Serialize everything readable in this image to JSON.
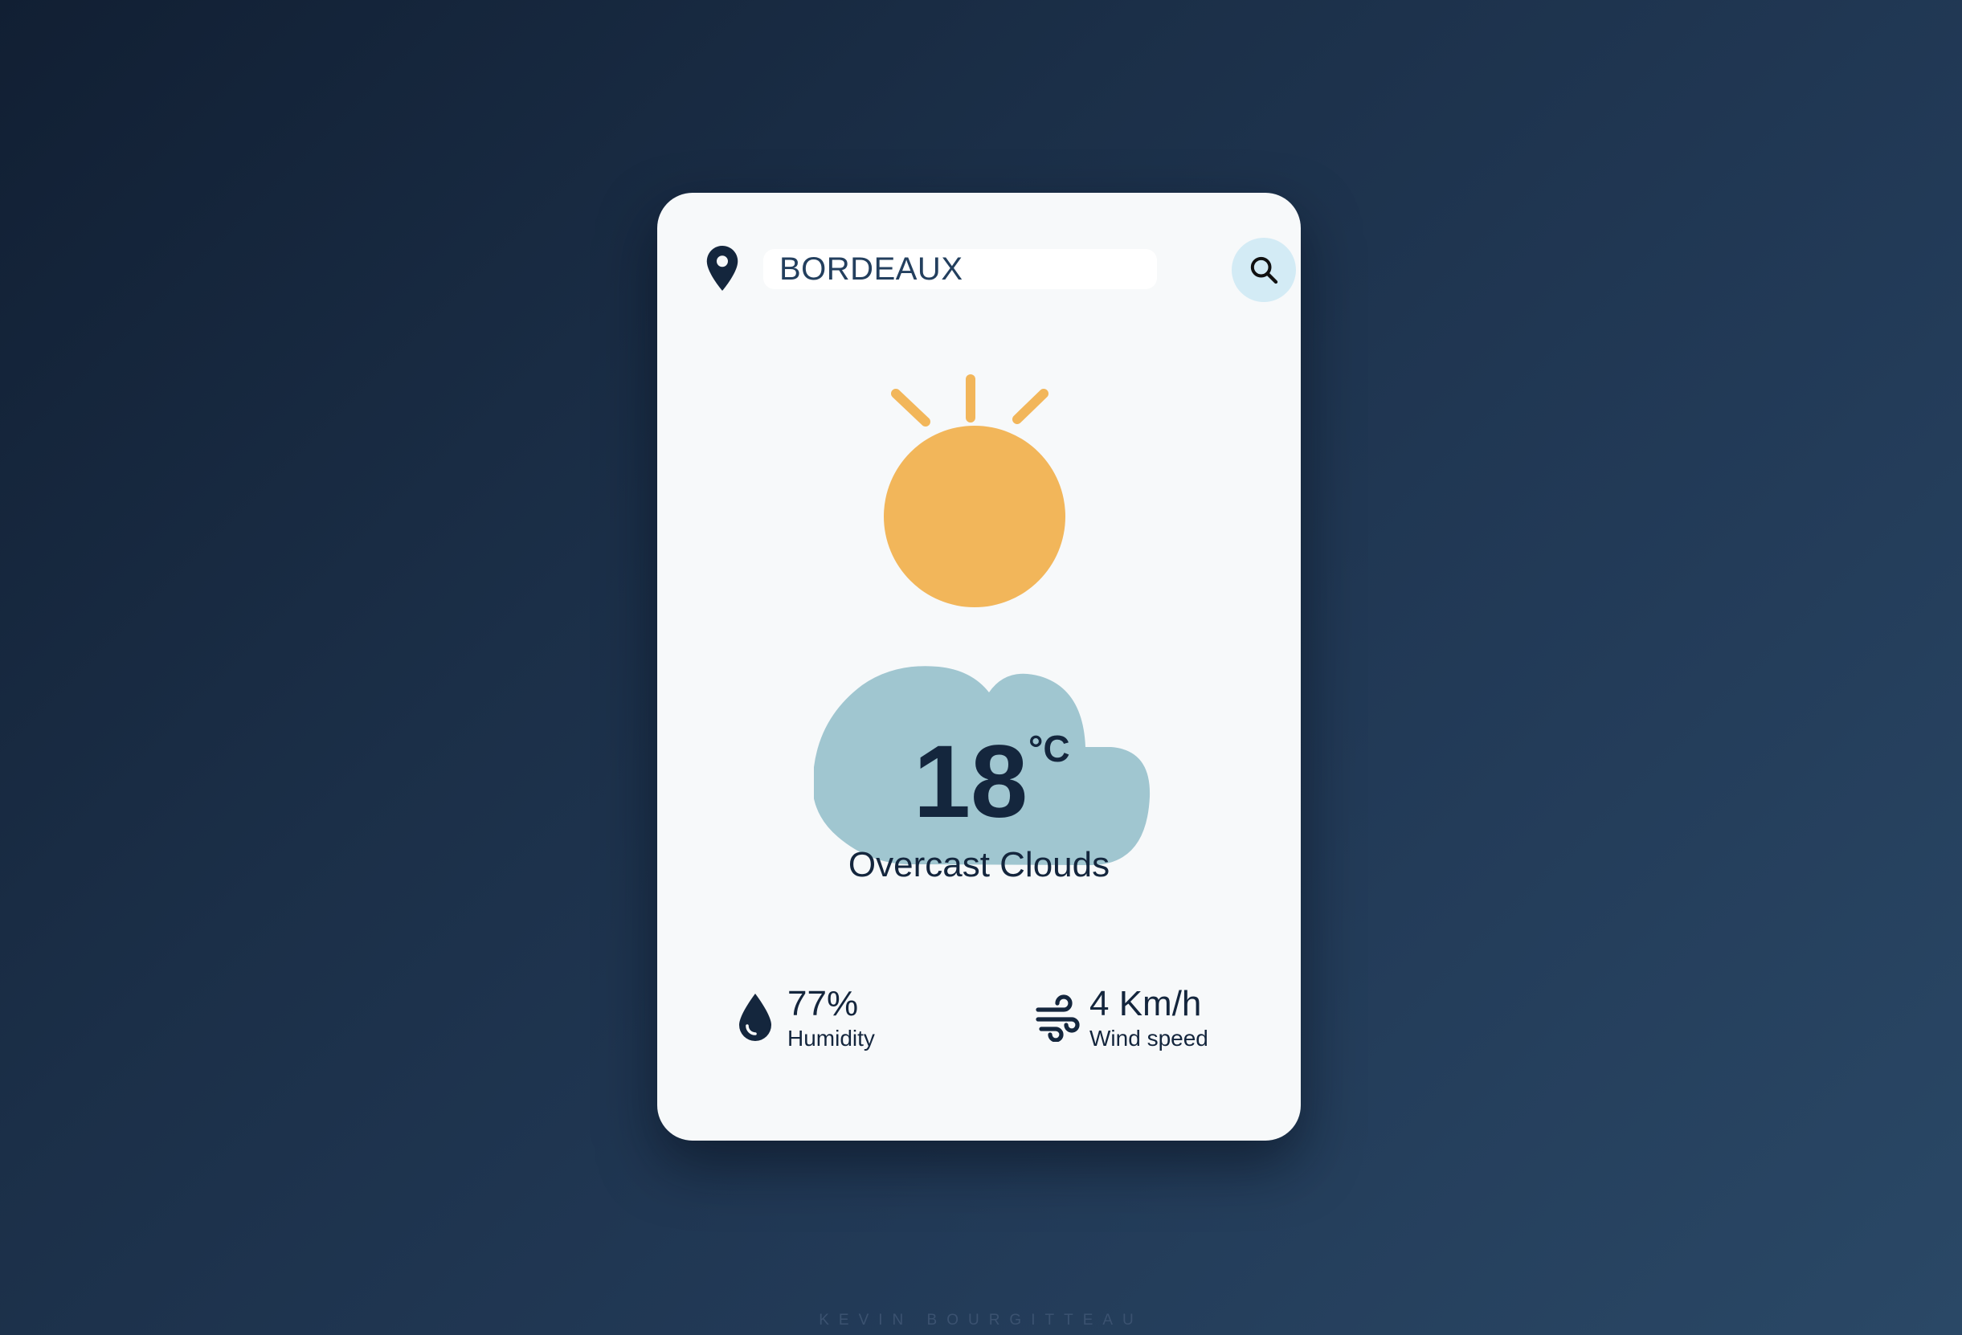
{
  "search": {
    "city_value": "BORDEAUX",
    "search_icon": "search-icon",
    "location_icon": "map-pin-icon"
  },
  "weather": {
    "icon": "sun-behind-cloud-icon",
    "temperature": "18",
    "unit": "°C",
    "condition": "Overcast Clouds"
  },
  "stats": {
    "humidity": {
      "icon": "water-drop-icon",
      "value": "77%",
      "label": "Humidity"
    },
    "wind": {
      "icon": "wind-icon",
      "value": "4 Km/h",
      "label": "Wind speed"
    }
  },
  "footer": {
    "credit": "KEVIN BOURGITTEAU"
  },
  "colors": {
    "background": "#1b2f48",
    "card": "#f7f9fa",
    "text": "#14263d",
    "sun": "#f2b65a",
    "cloud": "#a0c6d0",
    "search_button": "#d3ebf5"
  }
}
